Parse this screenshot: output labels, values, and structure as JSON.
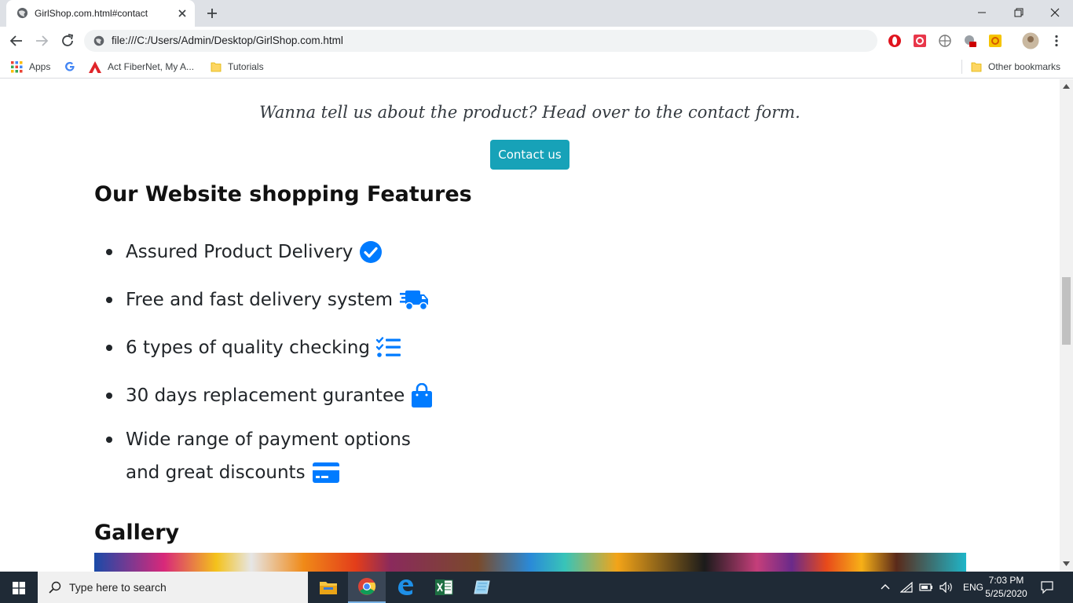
{
  "browser": {
    "tab": {
      "title": "GirlShop.com.html#contact"
    },
    "address": {
      "url": "file:///C:/Users/Admin/Desktop/GirlShop.com.html"
    },
    "bookmarks": {
      "apps": "Apps",
      "act": "Act FiberNet, My A...",
      "tutorials": "Tutorials",
      "other": "Other bookmarks"
    }
  },
  "page": {
    "tagline": "Wanna tell us about the product? Head over to the contact form.",
    "contact_button": "Contact us",
    "features_title": "Our Website shopping Features",
    "features": [
      {
        "text": "Assured Product Delivery",
        "icon": "check-circle-icon"
      },
      {
        "text": "Free and fast delivery system",
        "icon": "truck-icon"
      },
      {
        "text": "6 types of quality checking",
        "icon": "checklist-icon"
      },
      {
        "text": "30 days replacement gurantee",
        "icon": "shopping-bag-icon"
      },
      {
        "text_line1": "Wide range of payment options",
        "text_line2": "and great discounts",
        "icon": "credit-card-icon"
      }
    ],
    "gallery_title": "Gallery",
    "accent_color": "#17a2b8",
    "icon_color": "#007bff"
  },
  "taskbar": {
    "search_placeholder": "Type here to search",
    "language": "ENG",
    "time": "7:03 PM",
    "date": "5/25/2020"
  }
}
